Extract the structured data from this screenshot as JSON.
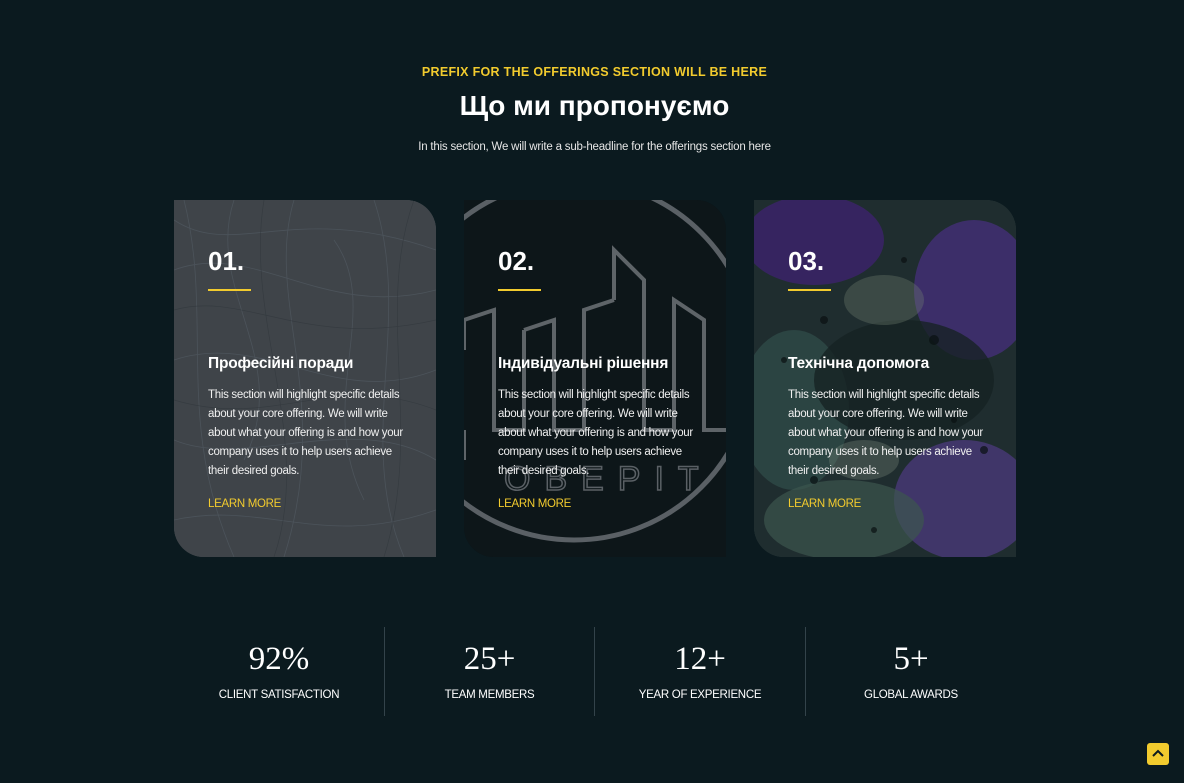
{
  "section": {
    "prefix": "PREFIX FOR THE OFFERINGS SECTION WILL BE HERE",
    "headline": "Що ми пропонуємо",
    "subheadline": "In this section, We will write a sub-headline for the offerings section here"
  },
  "cards": [
    {
      "number": "01.",
      "title": "Професійні поради",
      "description": "This section will highlight specific details about your core offering. We will write about what your offering is and how your company uses it to help users achieve their desired goals.",
      "link": "LEARN MORE"
    },
    {
      "number": "02.",
      "title": "Індивідуальні рішення",
      "description": "This section will highlight specific details about your core offering. We will write about what your offering is and how your company uses it to help users achieve their desired goals.",
      "link": "LEARN MORE"
    },
    {
      "number": "03.",
      "title": "Технічна допомога",
      "description": "This section will highlight specific details about your core offering. We will write about what your offering is and how your company uses it to help users achieve their desired goals.",
      "link": "LEARN MORE"
    }
  ],
  "stats": [
    {
      "value": "92%",
      "label": "CLIENT SATISFACTION"
    },
    {
      "value": "25+",
      "label": "TEAM MEMBERS"
    },
    {
      "value": "12+",
      "label": "YEAR OF EXPERIENCE"
    },
    {
      "value": "5+",
      "label": "GLOBAL AWARDS"
    }
  ],
  "colors": {
    "background": "#0b1a1f",
    "accent": "#f2cb2e",
    "text": "#ffffff"
  },
  "icons": {
    "scroll_top": "chevron-up-icon"
  }
}
